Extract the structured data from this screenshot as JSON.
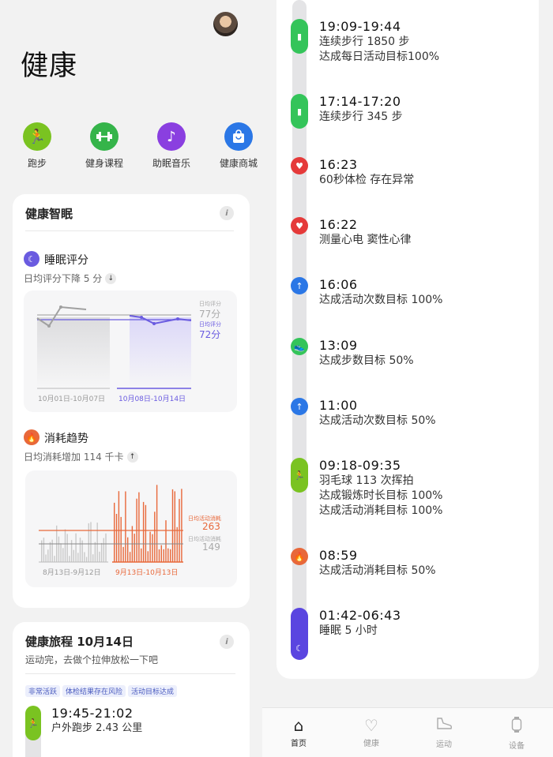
{
  "app_title": "健康",
  "quick_actions": [
    {
      "label": "跑步",
      "icon": "running-icon",
      "color": "#7ac321"
    },
    {
      "label": "健身课程",
      "icon": "dumbbell-icon",
      "color": "#35b44a"
    },
    {
      "label": "助眠音乐",
      "icon": "music-note-icon",
      "color": "#8a3fe0"
    },
    {
      "label": "健康商城",
      "icon": "shopping-bag-icon",
      "color": "#2b77e6"
    }
  ],
  "sleep_card": {
    "title": "健康智眠",
    "sleep_section": {
      "title": "睡眠评分",
      "subtitle": "日均评分下降 5 分",
      "trend": "down",
      "prev_label": "日均评分",
      "prev_value": "77分",
      "curr_label": "日均评分",
      "curr_value": "72分",
      "prev_range": "10月01日-10月07日",
      "curr_range": "10月08日-10月14日",
      "prev_scores": [
        77,
        75,
        78,
        77
      ],
      "curr_scores": [
        73,
        73,
        71,
        72,
        72
      ],
      "color": "#6a5be0"
    },
    "burn_section": {
      "title": "消耗趋势",
      "subtitle": "日均消耗增加 114 千卡",
      "trend": "up",
      "curr_label": "日均活动消耗",
      "curr_value": "263",
      "prev_label": "日均活动消耗",
      "prev_value": "149",
      "prev_range": "8月13日-9月12日",
      "curr_range": "9月13日-10月13日",
      "color": "#e8683a"
    }
  },
  "journey_card": {
    "title": "健康旅程",
    "date": "10月14日",
    "subtitle": "运动完，去做个拉伸放松一下吧",
    "tags": [
      "非常活跃",
      "体检结果存在风险",
      "活动目标达成"
    ],
    "item": {
      "time": "19:45-21:02",
      "line": "户外跑步 2.43 公里",
      "icon": "running-icon",
      "color": "#7ac321"
    }
  },
  "timeline": [
    {
      "time": "19:09-19:44",
      "lines": [
        "连续步行 1850 步",
        "达成每日活动目标100%"
      ],
      "icon": "bar-chart-icon",
      "color": "#34c45a",
      "pill": true
    },
    {
      "time": "17:14-17:20",
      "lines": [
        "连续步行 345 步"
      ],
      "icon": "bar-chart-icon",
      "color": "#34c45a",
      "pill": true
    },
    {
      "time": "16:23",
      "lines": [
        "60秒体检 存在异常"
      ],
      "icon": "heart-icon",
      "color": "#e53a3a",
      "pill": false
    },
    {
      "time": "16:22",
      "lines": [
        "测量心电 窦性心律"
      ],
      "icon": "heart-pulse-icon",
      "color": "#e53a3a",
      "pill": false
    },
    {
      "time": "16:06",
      "lines": [
        "达成活动次数目标 100%"
      ],
      "icon": "arrow-up-icon",
      "color": "#2b77e6",
      "pill": false
    },
    {
      "time": "13:09",
      "lines": [
        "达成步数目标 50%"
      ],
      "icon": "shoe-icon",
      "color": "#34c45a",
      "pill": false
    },
    {
      "time": "11:00",
      "lines": [
        "达成活动次数目标 50%"
      ],
      "icon": "arrow-up-icon",
      "color": "#2b77e6",
      "pill": false
    },
    {
      "time": "09:18-09:35",
      "lines": [
        "羽毛球 113 次挥拍",
        "达成锻炼时长目标 100%",
        "达成活动消耗目标 100%"
      ],
      "icon": "running-icon",
      "color": "#7ac321",
      "pill": true
    },
    {
      "time": "08:59",
      "lines": [
        "达成活动消耗目标 50%"
      ],
      "icon": "flame-icon",
      "color": "#e8683a",
      "pill": false
    },
    {
      "time": "01:42-06:43",
      "lines": [
        "睡眠 5 小时"
      ],
      "icon": "moon-icon",
      "color": "#5a45e0",
      "pill": true
    }
  ],
  "bottom_nav": [
    {
      "label": "首页",
      "icon": "home-icon",
      "active": true
    },
    {
      "label": "健康",
      "icon": "heart-outline-icon",
      "active": false
    },
    {
      "label": "运动",
      "icon": "shoe-outline-icon",
      "active": false
    },
    {
      "label": "设备",
      "icon": "watch-icon",
      "active": false
    }
  ]
}
